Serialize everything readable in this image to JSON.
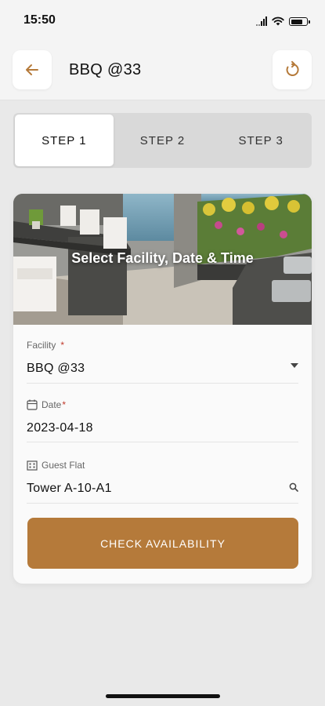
{
  "status_bar": {
    "time": "15:50"
  },
  "header": {
    "title": "BBQ @33",
    "back_icon": "arrow-left-icon",
    "refresh_icon": "refresh-icon",
    "accent_color": "#b57a3a"
  },
  "steps": [
    {
      "label": "STEP 1",
      "active": true
    },
    {
      "label": "STEP 2",
      "active": false
    },
    {
      "label": "STEP 3",
      "active": false
    }
  ],
  "card": {
    "hero_title": "Select Facility, Date & Time",
    "fields": {
      "facility": {
        "label": "Facility",
        "required_mark": "*",
        "value": "BBQ @33",
        "trailing_icon": "caret-down-icon"
      },
      "date": {
        "label": "Date",
        "required_mark": "*",
        "value": "2023-04-18",
        "leading_icon": "calendar-icon"
      },
      "guest_flat": {
        "label": "Guest Flat",
        "value": "Tower A-10-A1",
        "leading_icon": "building-icon",
        "trailing_icon": "search-icon"
      }
    },
    "button_label": "CHECK AVAILABILITY",
    "button_color": "#b57a3a"
  }
}
